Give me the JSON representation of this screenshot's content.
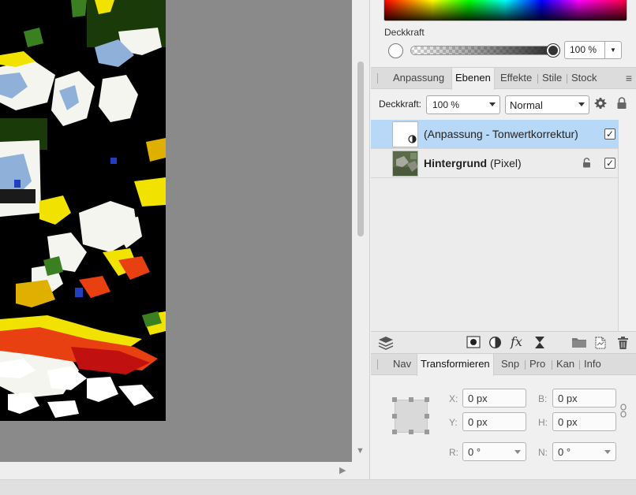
{
  "color_panel": {
    "opacity_label": "Deckkraft",
    "opacity_value": "100 %",
    "opacity_fraction": 1.0
  },
  "layers_tabs": [
    {
      "label": "Anpassung",
      "active": false
    },
    {
      "label": "Ebenen",
      "active": true
    },
    {
      "label": "Effekte",
      "active": false
    },
    {
      "label": "Stile",
      "active": false
    },
    {
      "label": "Stock",
      "active": false
    }
  ],
  "layer_options": {
    "opacity_label": "Deckkraft:",
    "opacity_value": "100 %",
    "blend_mode": "Normal"
  },
  "layers": [
    {
      "name": "(Anpassung - Tonwertkorrektur)",
      "type_suffix": "",
      "bold": false,
      "selected": true,
      "locked": false,
      "visible": true
    },
    {
      "name": "Hintergrund",
      "type_suffix": "(Pixel)",
      "bold": true,
      "selected": false,
      "locked": true,
      "visible": true
    }
  ],
  "transform_tabs": [
    {
      "label": "Nav",
      "active": false
    },
    {
      "label": "Transformieren",
      "active": true
    },
    {
      "label": "Snp",
      "active": false
    },
    {
      "label": "Pro",
      "active": false
    },
    {
      "label": "Kan",
      "active": false
    },
    {
      "label": "Info",
      "active": false
    }
  ],
  "transform": {
    "x_label": "X:",
    "x_value": "0 px",
    "y_label": "Y:",
    "y_value": "0 px",
    "w_label": "B:",
    "w_value": "0 px",
    "h_label": "H:",
    "h_value": "0 px",
    "r_label": "R:",
    "r_value": "0 °",
    "s_label": "N:",
    "s_value": "0 °"
  },
  "icons": {
    "check": "✓",
    "scroll_down": "▼",
    "scroll_right": "▶",
    "menu": "≡",
    "dropdown": "▼"
  }
}
